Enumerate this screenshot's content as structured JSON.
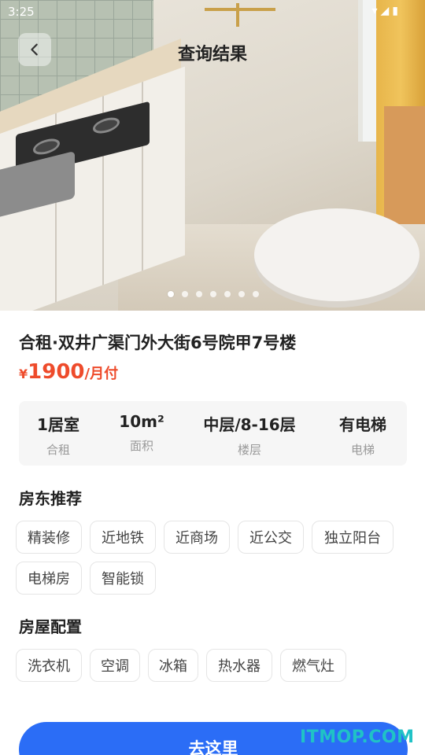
{
  "status_bar": {
    "time": "3:25"
  },
  "header": {
    "title": "查询结果",
    "back_icon": "chevron-left-icon"
  },
  "gallery": {
    "page_count": 7,
    "current_index": 0
  },
  "listing": {
    "title": "合租·双井广渠门外大街6号院甲7号楼",
    "price": {
      "currency": "¥",
      "amount": "1900",
      "unit": "/月付",
      "color": "#ee4b2b"
    }
  },
  "stats": [
    {
      "value": "1居室",
      "label": "合租"
    },
    {
      "value": "10m²",
      "label": "面积"
    },
    {
      "value": "中层/8-16层",
      "label": "楼层"
    },
    {
      "value": "有电梯",
      "label": "电梯"
    }
  ],
  "landlord_recommend": {
    "title": "房东推荐",
    "tags": [
      "精装修",
      "近地铁",
      "近商场",
      "近公交",
      "独立阳台",
      "电梯房",
      "智能锁"
    ]
  },
  "facilities": {
    "title": "房屋配置",
    "tags": [
      "洗衣机",
      "空调",
      "冰箱",
      "热水器",
      "燃气灶"
    ]
  },
  "action": {
    "go_label": "去这里",
    "color": "#2b6df6"
  },
  "watermark": "ITMOP.COM"
}
